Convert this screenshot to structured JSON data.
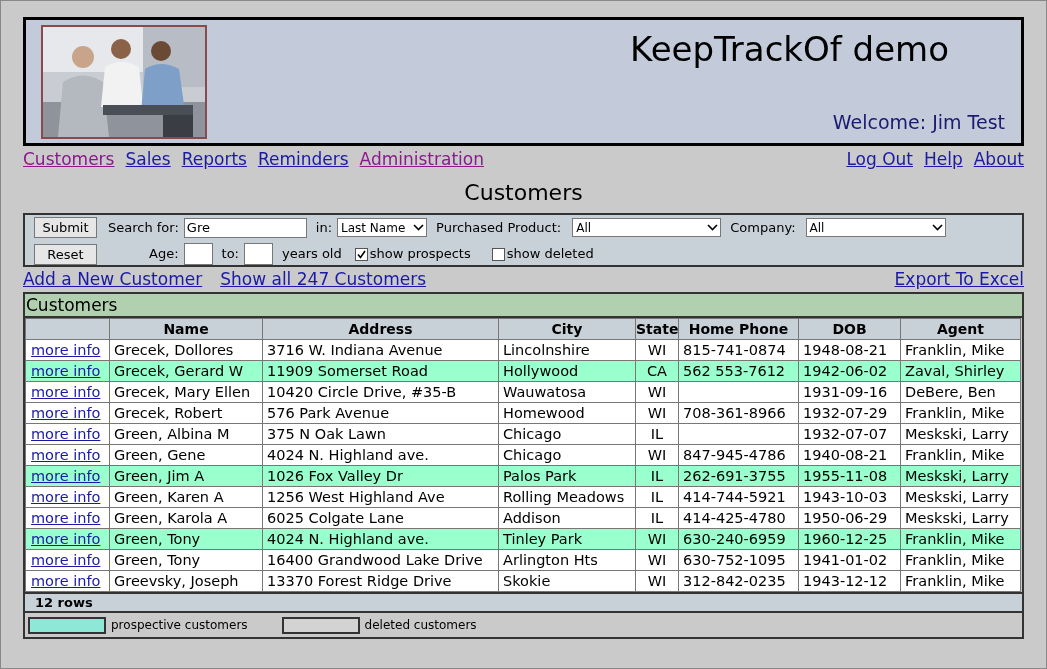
{
  "header": {
    "title": "KeepTrackOf demo",
    "welcome": "Welcome: Jim Test"
  },
  "nav_left": [
    {
      "label": "Customers",
      "visited": true
    },
    {
      "label": "Sales",
      "visited": false
    },
    {
      "label": "Reports",
      "visited": false
    },
    {
      "label": "Reminders",
      "visited": false
    },
    {
      "label": "Administration",
      "visited": true
    }
  ],
  "nav_right": [
    {
      "label": "Log Out",
      "visited": false
    },
    {
      "label": "Help",
      "visited": false
    },
    {
      "label": "About",
      "visited": false
    }
  ],
  "page_title": "Customers",
  "search": {
    "submit": "Submit",
    "reset": "Reset",
    "search_label": "Search for:",
    "search_value": "Gre",
    "in_label": "in:",
    "in_value": "Last Name",
    "product_label": "Purchased Product:",
    "product_value": "All",
    "company_label": "Company:",
    "company_value": "All",
    "age_label": "Age:",
    "to_label": "to:",
    "years_label": "years old",
    "show_prospects": {
      "label": "show prospects",
      "checked": true
    },
    "show_deleted": {
      "label": "show deleted",
      "checked": false
    }
  },
  "links": {
    "add": "Add a New Customer",
    "show_all": "Show all 247 Customers",
    "export": "Export To Excel"
  },
  "table": {
    "title": "Customers",
    "columns": [
      "",
      "Name",
      "Address",
      "City",
      "State",
      "Home Phone",
      "DOB",
      "Agent"
    ],
    "rows": [
      {
        "link": "more info",
        "name": "Grecek, Dollores",
        "address": "3716 W. Indiana Avenue",
        "city": "Lincolnshire",
        "state": "WI",
        "phone": "815-741-0874",
        "dob": "1948-08-21",
        "agent": "Franklin, Mike",
        "prospect": false
      },
      {
        "link": "more info",
        "name": "Grecek, Gerard W",
        "address": "11909 Somerset Road",
        "city": "Hollywood",
        "state": "CA",
        "phone": "562 553-7612",
        "dob": "1942-06-02",
        "agent": "Zaval, Shirley",
        "prospect": true
      },
      {
        "link": "more info",
        "name": "Grecek, Mary Ellen",
        "address": "10420 Circle Drive, #35-B",
        "city": "Wauwatosa",
        "state": "WI",
        "dob": "1931-09-16",
        "agent": "DeBere, Ben",
        "prospect": false
      },
      {
        "link": "more info",
        "name": "Grecek, Robert",
        "address": "576 Park Avenue",
        "city": "Homewood",
        "state": "WI",
        "phone": "708-361-8966",
        "dob": "1932-07-29",
        "agent": "Franklin, Mike",
        "prospect": false
      },
      {
        "link": "more info",
        "name": "Green, Albina M",
        "address": "375 N Oak Lawn",
        "city": "Chicago",
        "state": "IL",
        "dob": "1932-07-07",
        "agent": "Meskski, Larry",
        "prospect": false
      },
      {
        "link": "more info",
        "name": "Green, Gene",
        "address": "4024 N. Highland ave.",
        "city": "Chicago",
        "state": "WI",
        "phone": "847-945-4786",
        "dob": "1940-08-21",
        "agent": "Franklin, Mike",
        "prospect": false
      },
      {
        "link": "more info",
        "name": "Green, Jim A",
        "address": "1026 Fox Valley Dr",
        "city": "Palos Park",
        "state": "IL",
        "phone": "262-691-3755",
        "dob": "1955-11-08",
        "agent": "Meskski, Larry",
        "prospect": true
      },
      {
        "link": "more info",
        "name": "Green, Karen A",
        "address": "1256 West Highland Ave",
        "city": "Rolling Meadows",
        "state": "IL",
        "phone": "414-744-5921",
        "dob": "1943-10-03",
        "agent": "Meskski, Larry",
        "prospect": false
      },
      {
        "link": "more info",
        "name": "Green, Karola A",
        "address": "6025 Colgate Lane",
        "city": "Addison",
        "state": "IL",
        "phone": "414-425-4780",
        "dob": "1950-06-29",
        "agent": "Meskski, Larry",
        "prospect": false
      },
      {
        "link": "more info",
        "name": "Green, Tony",
        "address": "4024 N. Highland ave.",
        "city": "Tinley Park",
        "state": "WI",
        "phone": "630-240-6959",
        "dob": "1960-12-25",
        "agent": "Franklin, Mike",
        "prospect": true
      },
      {
        "link": "more info",
        "name": "Green, Tony",
        "address": "16400 Grandwood Lake Drive",
        "city": "Arlington Hts",
        "state": "WI",
        "phone": "630-752-1095",
        "dob": "1941-01-02",
        "agent": "Franklin, Mike",
        "prospect": false
      },
      {
        "link": "more info",
        "name": "Greevsky, Joseph",
        "address": "13370 Forest Ridge Drive",
        "city": "Skokie",
        "state": "WI",
        "phone": "312-842-0235",
        "dob": "1943-12-12",
        "agent": "Franklin, Mike",
        "prospect": false
      }
    ],
    "row_count": "12 rows"
  },
  "legend": [
    {
      "label": "prospective customers",
      "color": "#8ee8d8"
    },
    {
      "label": "deleted customers",
      "color": "#d3d3d3"
    }
  ]
}
